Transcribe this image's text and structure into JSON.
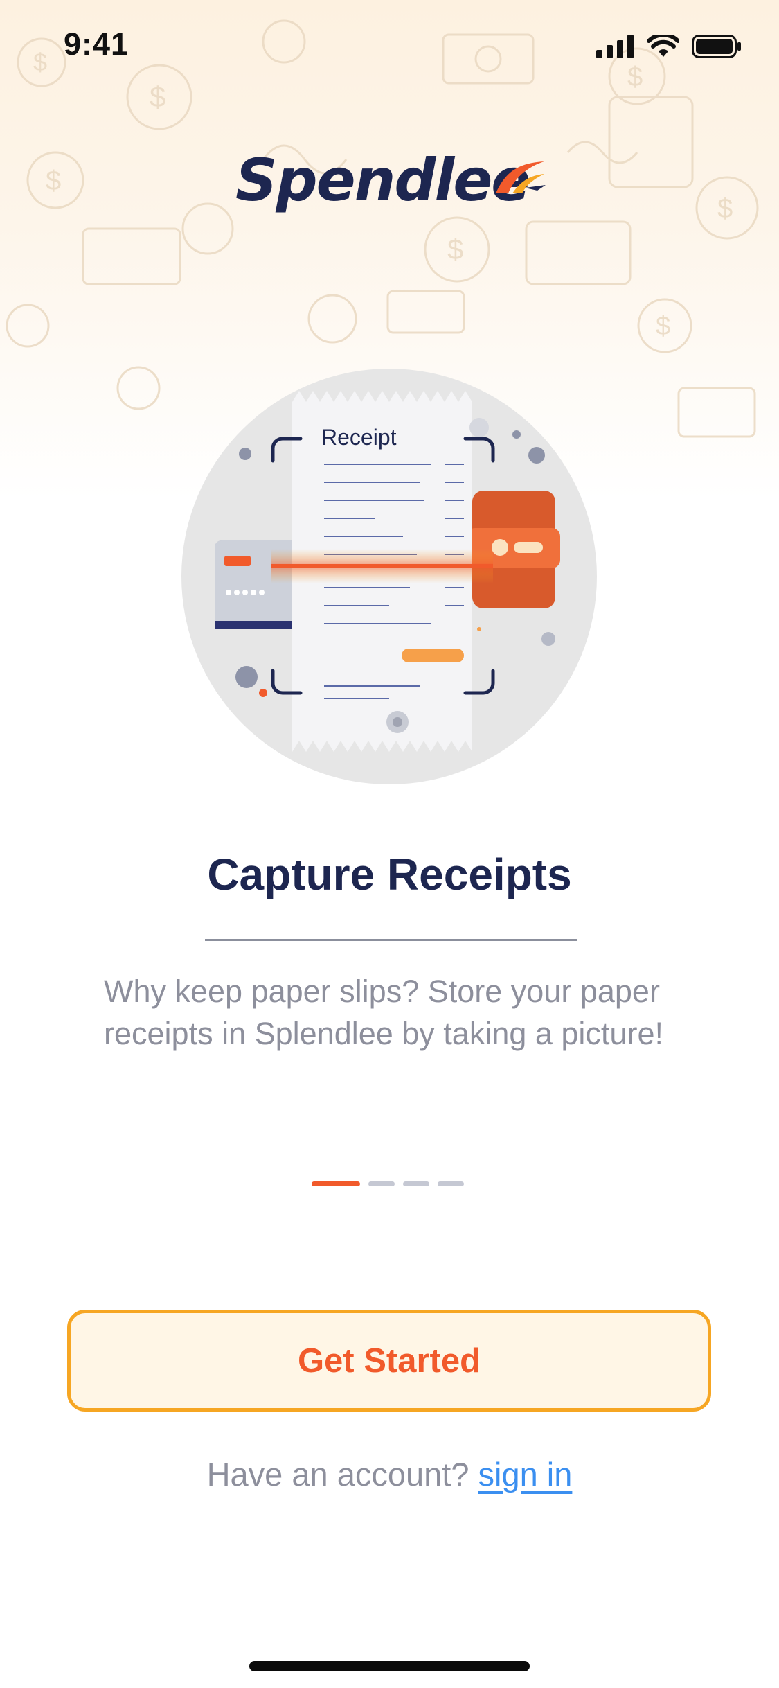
{
  "status_bar": {
    "time": "9:41"
  },
  "brand": {
    "name": "Spendlee",
    "navy": "#1d2650",
    "orange": "#f15a2b"
  },
  "illustration": {
    "receipt_heading": "Receipt"
  },
  "onboarding": {
    "title": "Capture Receipts",
    "description": "Why keep paper slips? Store your paper receipts in Splendlee by taking a picture!",
    "page_index": 1,
    "page_count": 4
  },
  "actions": {
    "primary_label": "Get Started",
    "account_prompt": "Have an account?",
    "signin_label": "sign in"
  },
  "colors": {
    "accent": "#f15a2b",
    "button_border": "#f6a623",
    "button_bg": "#fff6e6",
    "link": "#3b8ff0"
  },
  "icons": [
    "cellular-signal-icon",
    "wifi-icon",
    "battery-icon",
    "logo-swoosh-icon"
  ]
}
